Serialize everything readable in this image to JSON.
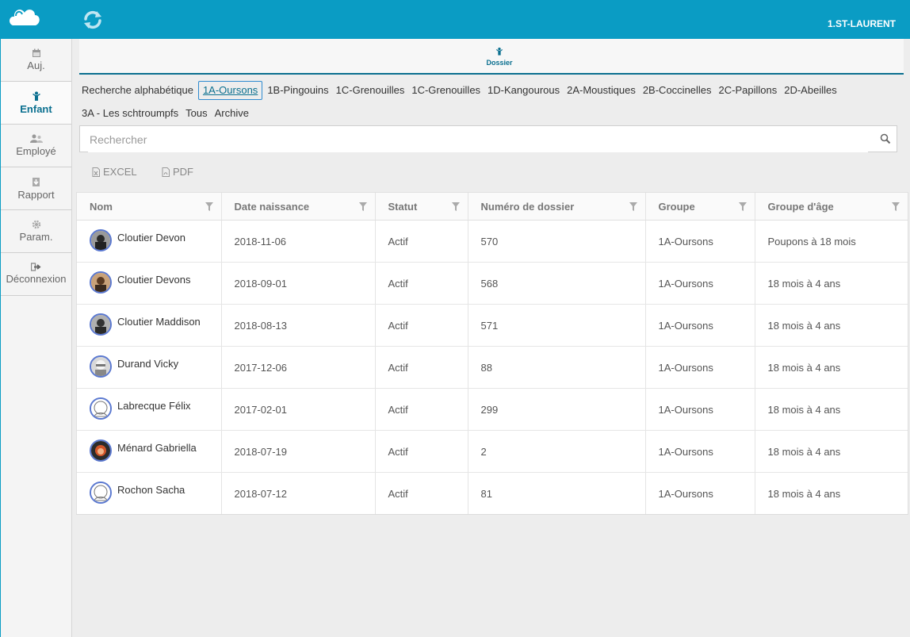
{
  "header": {
    "site": "1.ST-LAURENT"
  },
  "sidebar": {
    "items": [
      {
        "label": "Auj."
      },
      {
        "label": "Enfant"
      },
      {
        "label": "Employé"
      },
      {
        "label": "Rapport"
      },
      {
        "label": "Param."
      },
      {
        "label": "Déconnexion"
      }
    ],
    "active": "Enfant"
  },
  "breadcrumb": {
    "label": "Dossier"
  },
  "tabs": [
    "Recherche alphabétique",
    "1A-Oursons",
    "1B-Pingouins",
    "1C-Grenouilles",
    "1C-Grenouilles",
    "1D-Kangourous",
    "2A-Moustiques",
    "2B-Coccinelles",
    "2C-Papillons",
    "2D-Abeilles",
    "3A - Les schtroumpfs",
    "Tous",
    "Archive"
  ],
  "active_tab": "1A-Oursons",
  "search": {
    "placeholder": "Rechercher",
    "value": ""
  },
  "toolbar": {
    "excel": "EXCEL",
    "pdf": "PDF"
  },
  "table": {
    "columns": [
      "Nom",
      "Date naissance",
      "Statut",
      "Numéro de dossier",
      "Groupe",
      "Groupe d'âge"
    ],
    "rows": [
      {
        "nom": "Cloutier Devon",
        "date": "2018-11-06",
        "statut": "Actif",
        "numero": "570",
        "groupe": "1A-Oursons",
        "age": "Poupons à 18 mois",
        "avatar": "photo-dark"
      },
      {
        "nom": "Cloutier Devons",
        "date": "2018-09-01",
        "statut": "Actif",
        "numero": "568",
        "groupe": "1A-Oursons",
        "age": "18 mois à 4 ans",
        "avatar": "photo-tan"
      },
      {
        "nom": "Cloutier Maddison",
        "date": "2018-08-13",
        "statut": "Actif",
        "numero": "571",
        "groupe": "1A-Oursons",
        "age": "18 mois à 4 ans",
        "avatar": "photo-dark"
      },
      {
        "nom": "Durand Vicky",
        "date": "2017-12-06",
        "statut": "Actif",
        "numero": "88",
        "groupe": "1A-Oursons",
        "age": "18 mois à 4 ans",
        "avatar": "photo-grey"
      },
      {
        "nom": "Labrecque Félix",
        "date": "2017-02-01",
        "statut": "Actif",
        "numero": "299",
        "groupe": "1A-Oursons",
        "age": "18 mois à 4 ans",
        "avatar": "placeholder"
      },
      {
        "nom": "Ménard Gabriella",
        "date": "2018-07-19",
        "statut": "Actif",
        "numero": "2",
        "groupe": "1A-Oursons",
        "age": "18 mois à 4 ans",
        "avatar": "photo-red"
      },
      {
        "nom": "Rochon Sacha",
        "date": "2018-07-12",
        "statut": "Actif",
        "numero": "81",
        "groupe": "1A-Oursons",
        "age": "18 mois à 4 ans",
        "avatar": "placeholder"
      }
    ]
  },
  "colors": {
    "header": "#0a9cc4",
    "accent": "#0a6f8f",
    "avatar_border": "#5a78d0"
  }
}
